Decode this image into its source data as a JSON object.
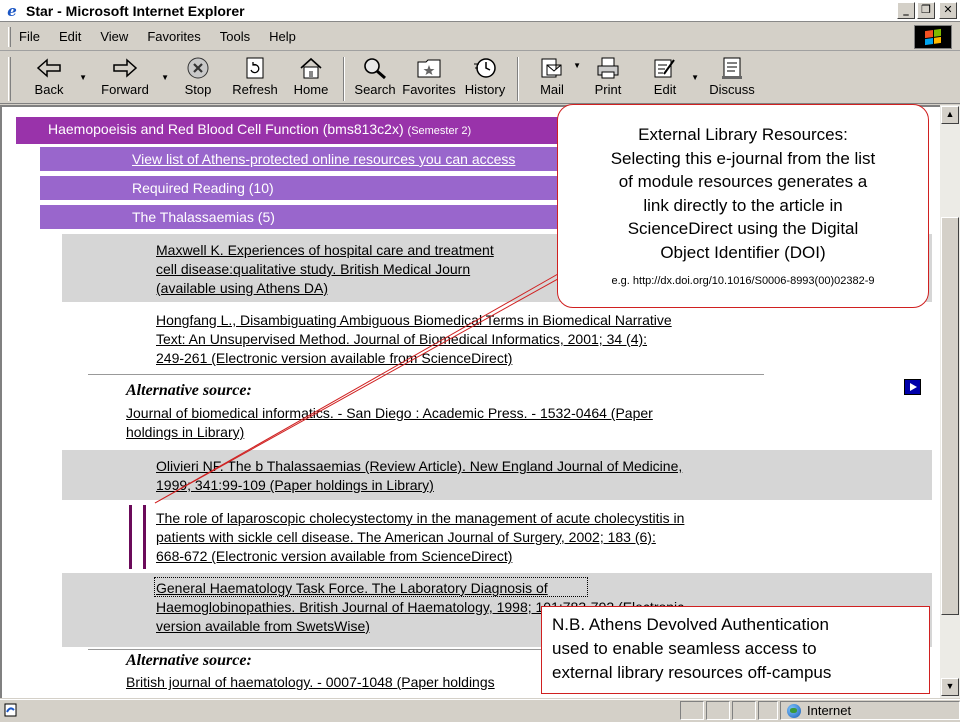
{
  "window": {
    "title": "Star - Microsoft Internet Explorer"
  },
  "menu": [
    "File",
    "Edit",
    "View",
    "Favorites",
    "Tools",
    "Help"
  ],
  "toolbar": {
    "back": "Back",
    "forward": "Forward",
    "stop": "Stop",
    "refresh": "Refresh",
    "home": "Home",
    "search": "Search",
    "favorites": "Favorites",
    "history": "History",
    "mail": "Mail",
    "print": "Print",
    "edit": "Edit",
    "discuss": "Discuss"
  },
  "page": {
    "module_title": "Haemopoeisis and Red Blood Cell Function (bms813c2x)",
    "semester": "(Semester 2)",
    "athens_link": "View list of Athens-protected online resources you can access",
    "required_reading": "Required Reading   (10)",
    "thalassaemias": "The Thalassaemias   (5)",
    "refs": [
      {
        "lines": [
          "Maxwell K. Experiences of hospital care and treatment",
          "cell disease:qualitative study. British Medical Journ",
          "(available using Athens DA)"
        ]
      },
      {
        "lines": [
          "Hongfang L., Disambiguating Ambiguous Biomedical Terms in Biomedical Narrative",
          "Text: An Unsupervised Method. Journal of Biomedical Informatics, 2001; 34 (4):",
          "249-261 (Electronic version available from ScienceDirect)"
        ]
      },
      {
        "lines": [
          "Olivieri NF. The b Thalassaemias (Review Article). New England Journal of Medicine,",
          "1999; 341:99-109 (Paper holdings in Library)"
        ]
      },
      {
        "lines": [
          "The role of laparoscopic cholecystectomy in the management of acute cholecystitis in",
          "patients with sickle cell disease. The American Journal of Surgery, 2002; 183 (6):",
          "668-672 (Electronic version available from ScienceDirect)"
        ]
      },
      {
        "lines": [
          "General Haematology Task Force. The Laboratory Diagnosis of",
          "Haemoglobinopathies. British Journal of Haematology, 1998; 101:783-792 (Electronic",
          "version available from SwetsWise)"
        ]
      }
    ],
    "alternatives": [
      {
        "title": "Alternative source:",
        "lines": [
          "Journal of biomedical informatics. - San Diego : Academic Press. - 1532-0464 (Paper",
          "holdings in Library)"
        ]
      },
      {
        "title": "Alternative source:",
        "lines": [
          "British journal of haematology. - 0007-1048 (Paper holdings"
        ]
      }
    ]
  },
  "callouts": {
    "top": {
      "lines": [
        "External Library Resources:",
        "Selecting this e-journal from the list",
        "of module resources generates a",
        "link directly to the article in",
        "ScienceDirect using the Digital",
        "Object Identifier (DOI)"
      ],
      "example": "e.g. http://dx.doi.org/10.1016/S0006-8993(00)02382-9"
    },
    "bottom": {
      "lines": [
        "N.B. Athens Devolved Authentication",
        "used to enable seamless access to",
        "external library resources off-campus"
      ]
    }
  },
  "status": {
    "zone": "Internet"
  },
  "colors": {
    "header": "#9933aa",
    "bar": "#9966cc",
    "callout_border": "#d02020",
    "marker": "#6b0a5a"
  }
}
